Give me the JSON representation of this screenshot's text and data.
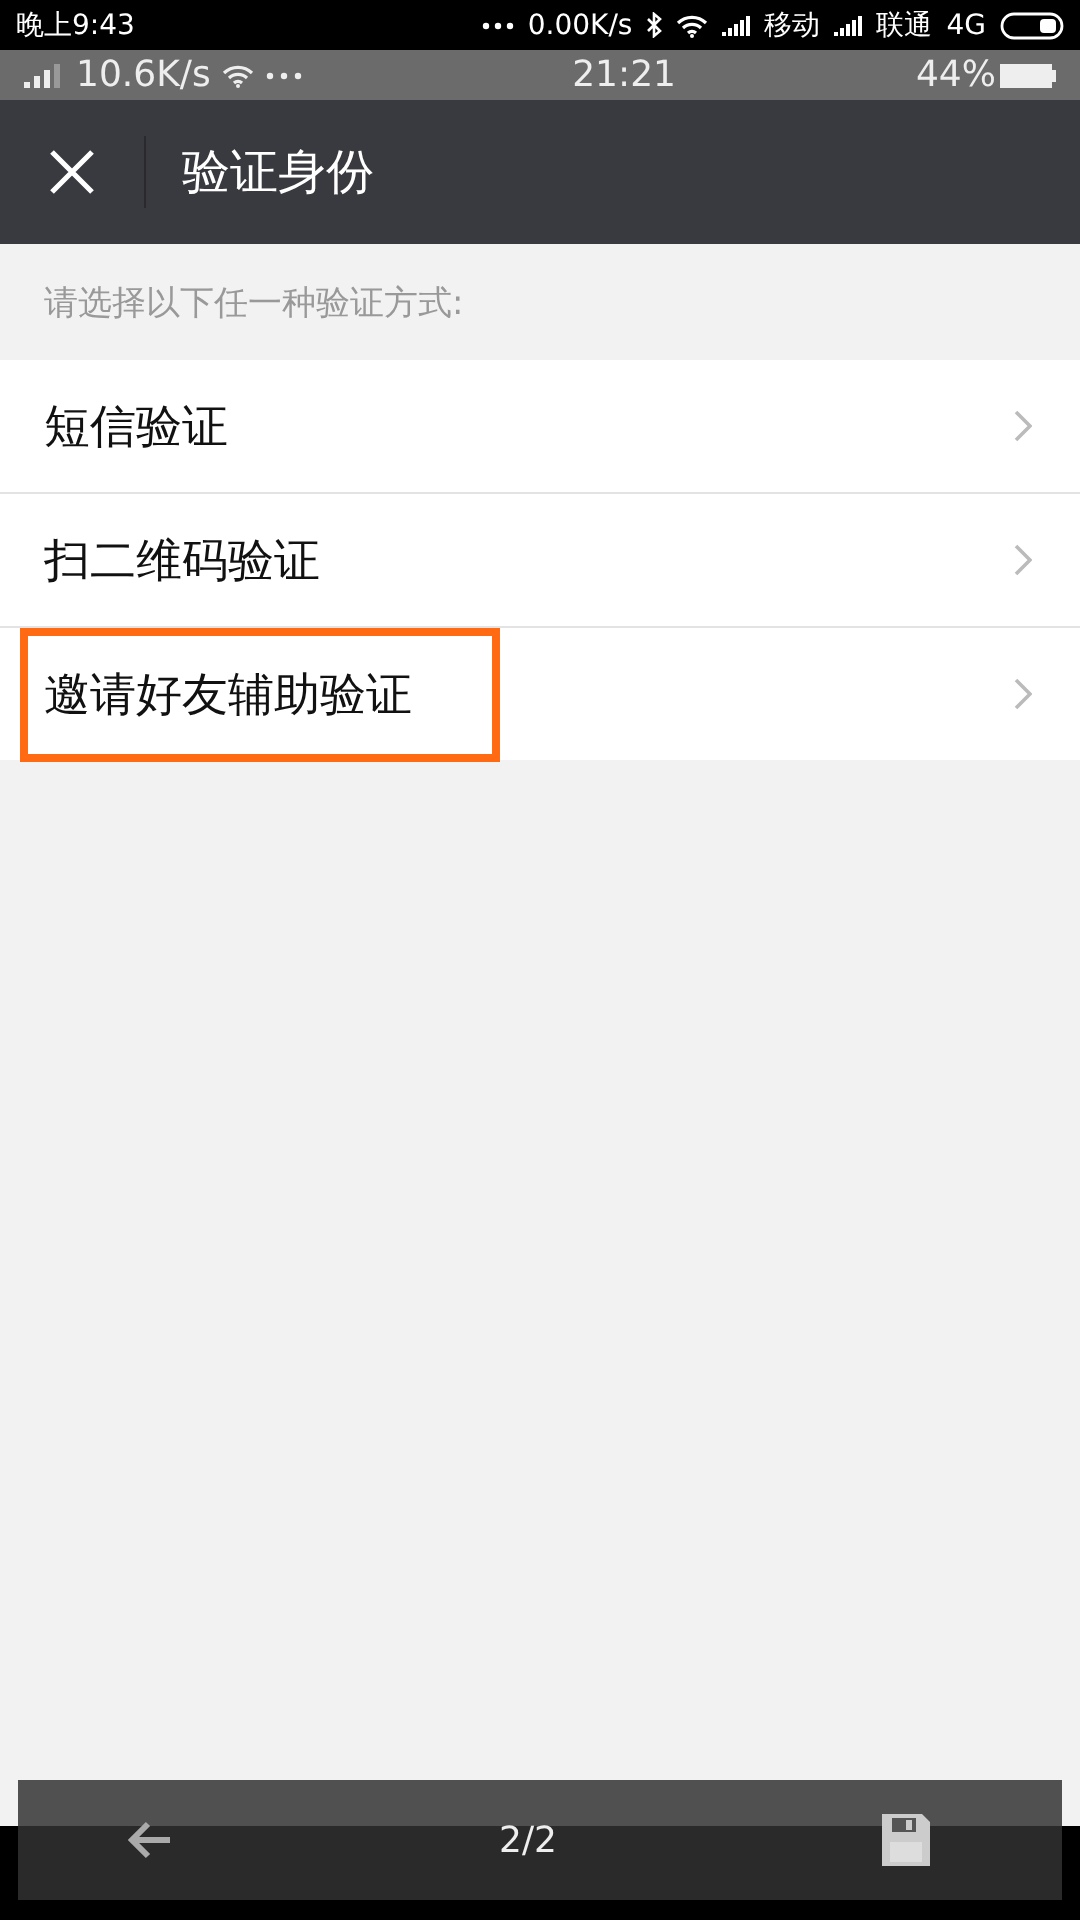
{
  "status_bar": {
    "time": "晚上9:43",
    "speed": "0.00K/s",
    "carrier_1": "移动",
    "carrier_2": "联通",
    "network": "4G"
  },
  "inner_status_bar": {
    "speed": "10.6K/s",
    "time": "21:21",
    "battery": "44%"
  },
  "header": {
    "title": "验证身份"
  },
  "hint": "请选择以下任一种验证方式:",
  "options": [
    {
      "label": "短信验证",
      "highlighted": false
    },
    {
      "label": "扫二维码验证",
      "highlighted": false
    },
    {
      "label": "邀请好友辅助验证",
      "highlighted": true
    }
  ],
  "viewer_toolbar": {
    "page": "2/2"
  }
}
